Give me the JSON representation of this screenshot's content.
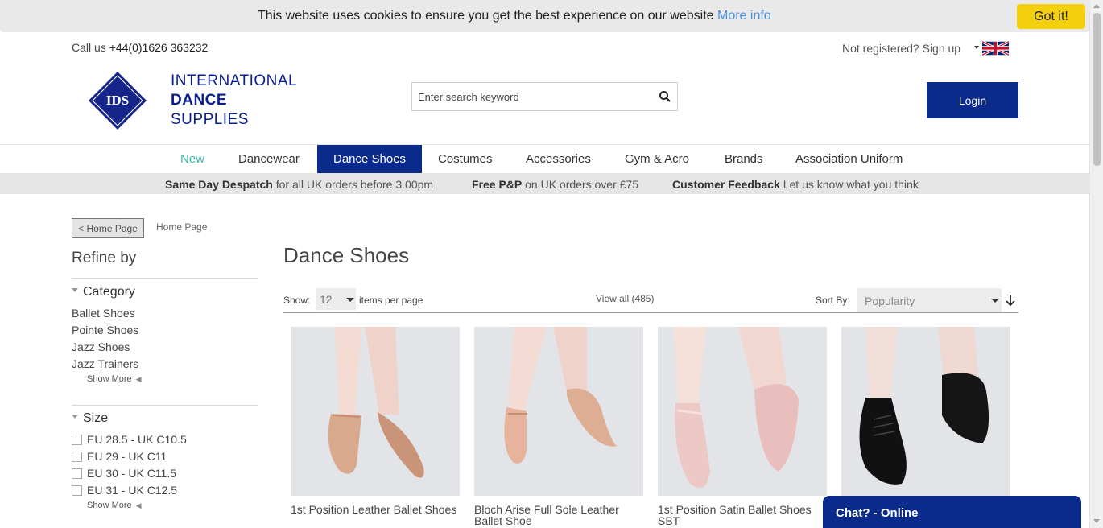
{
  "cookie": {
    "text": "This website uses cookies to ensure you get the best experience on our website",
    "link": "More info",
    "button": "Got it!"
  },
  "header": {
    "phone_prefix": "Call us",
    "phone_number": "+44(0)1626 363232",
    "signup": "Not registered? Sign up",
    "logo_mark": "IDS",
    "logo_line1": "INTERNATIONAL",
    "logo_line2": "DANCE",
    "logo_line3": "SUPPLIES",
    "search_placeholder": "Enter search keyword",
    "login": "Login",
    "flag_icon": "uk-flag-icon"
  },
  "nav": {
    "items": [
      "New",
      "Dancewear",
      "Dance Shoes",
      "Costumes",
      "Accessories",
      "Gym & Acro",
      "Brands",
      "Association Uniform"
    ],
    "active": "Dance Shoes"
  },
  "infobar": [
    {
      "bold": "Same Day Despatch",
      "text": "for all UK orders before 3.00pm"
    },
    {
      "bold": "Free P&P",
      "text": "on UK orders over £75"
    },
    {
      "bold": "Customer Feedback",
      "text": "Let us know what you think"
    }
  ],
  "sidebar": {
    "back_button": "< Home Page",
    "breadcrumb": "Home Page",
    "refine": "Refine by",
    "category_title": "Category",
    "categories": [
      "Ballet Shoes",
      "Pointe Shoes",
      "Jazz Shoes",
      "Jazz Trainers"
    ],
    "show_more": "Show More",
    "size_title": "Size",
    "sizes": [
      "EU 28.5 - UK C10.5",
      "EU 29 - UK C11",
      "EU 30 - UK C11.5",
      "EU 31 - UK C12.5"
    ]
  },
  "main": {
    "title": "Dance Shoes",
    "show_label": "Show:",
    "per_page_value": "12",
    "per_page_label": "items per page",
    "view_all": "View all (485)",
    "sort_label": "Sort By:",
    "sort_value": "Popularity"
  },
  "products": [
    {
      "name": "1st Position Leather Ballet Shoes",
      "shoe_color": "#d9a98e"
    },
    {
      "name": "Bloch Arise Full Sole Leather Ballet Shoe",
      "shoe_color": "#e6b49c"
    },
    {
      "name": "1st Position Satin Ballet Shoes SBT",
      "shoe_color": "#edc9c6"
    },
    {
      "name": "",
      "shoe_color": "#111111"
    }
  ],
  "chat": {
    "label": "Chat? - Online"
  },
  "colors": {
    "brand_blue": "#0a2a8c",
    "accent_teal": "#3bb7a8",
    "cookie_button": "#f5d00f"
  }
}
